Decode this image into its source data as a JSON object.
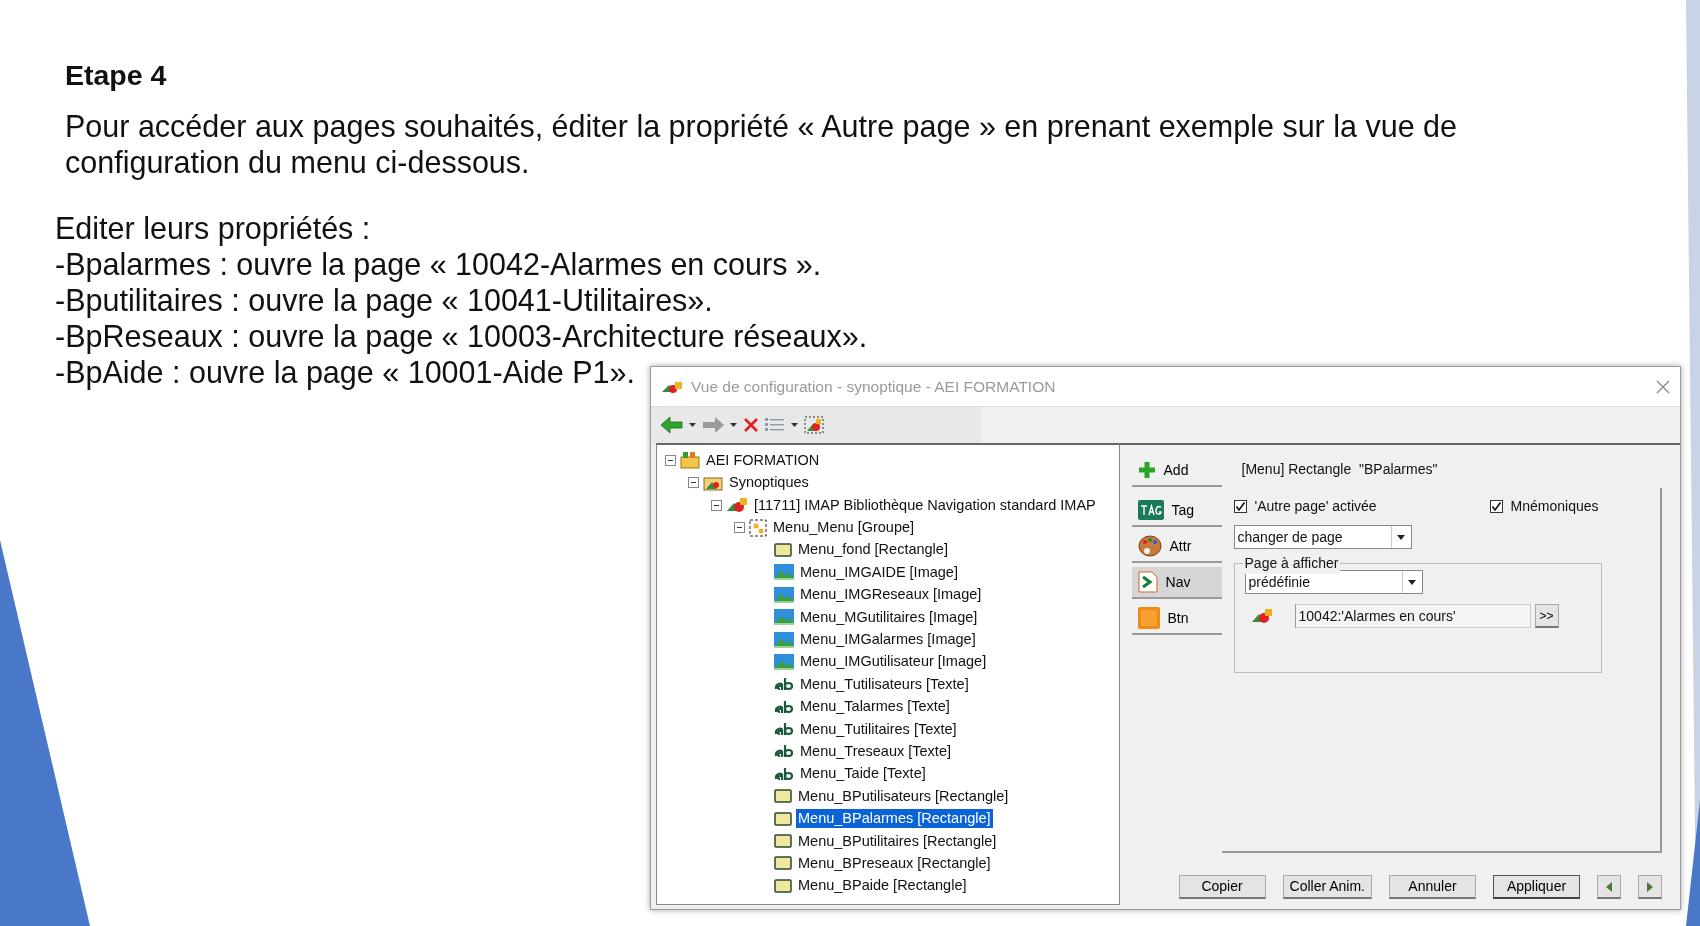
{
  "slide": {
    "title": "Etape 4",
    "intro": "Pour accéder aux pages souhaités, éditer la propriété « Autre page » en prenant exemple sur la vue de configuration du menu ci-dessous.",
    "list_heading": "Editer leurs propriétés :",
    "lines": [
      "-Bpalarmes : ouvre la page « 10042-Alarmes en cours ».",
      "-Bputilitaires : ouvre la page « 10041-Utilitaires».",
      "-BpReseaux : ouvre la page « 10003-Architecture réseaux».",
      "-BpAide : ouvre la page « 10001-Aide P1»."
    ]
  },
  "dialog": {
    "title": "Vue de configuration - synoptique - AEI FORMATION",
    "tree": [
      {
        "label": "AEI FORMATION",
        "kind": "project",
        "expanded": true,
        "selected": false,
        "children": [
          {
            "label": "Synoptiques",
            "kind": "folder",
            "expanded": true,
            "selected": false,
            "children": [
              {
                "label": "[11711]  IMAP Bibliothèque Navigation standard IMAP",
                "kind": "synoptic",
                "expanded": true,
                "selected": false,
                "children": [
                  {
                    "label": "Menu_Menu [Groupe]",
                    "kind": "group",
                    "expanded": true,
                    "selected": false,
                    "children": [
                      {
                        "label": "Menu_fond [Rectangle]",
                        "kind": "rectangle",
                        "selected": false
                      },
                      {
                        "label": "Menu_IMGAIDE [Image]",
                        "kind": "image",
                        "selected": false
                      },
                      {
                        "label": "Menu_IMGReseaux [Image]",
                        "kind": "image",
                        "selected": false
                      },
                      {
                        "label": "Menu_MGutilitaires [Image]",
                        "kind": "image",
                        "selected": false
                      },
                      {
                        "label": "Menu_IMGalarmes [Image]",
                        "kind": "image",
                        "selected": false
                      },
                      {
                        "label": "Menu_IMGutilisateur [Image]",
                        "kind": "image",
                        "selected": false
                      },
                      {
                        "label": "Menu_Tutilisateurs [Texte]",
                        "kind": "text",
                        "selected": false
                      },
                      {
                        "label": "Menu_Talarmes [Texte]",
                        "kind": "text",
                        "selected": false
                      },
                      {
                        "label": "Menu_Tutilitaires [Texte]",
                        "kind": "text",
                        "selected": false
                      },
                      {
                        "label": "Menu_Treseaux [Texte]",
                        "kind": "text",
                        "selected": false
                      },
                      {
                        "label": "Menu_Taide [Texte]",
                        "kind": "text",
                        "selected": false
                      },
                      {
                        "label": "Menu_BPutilisateurs [Rectangle]",
                        "kind": "rectangle",
                        "selected": false
                      },
                      {
                        "label": "Menu_BPalarmes [Rectangle]",
                        "kind": "rectangle",
                        "selected": true
                      },
                      {
                        "label": "Menu_BPutilitaires [Rectangle]",
                        "kind": "rectangle",
                        "selected": false
                      },
                      {
                        "label": "Menu_BPreseaux [Rectangle]",
                        "kind": "rectangle",
                        "selected": false
                      },
                      {
                        "label": "Menu_BPaide [Rectangle]",
                        "kind": "rectangle",
                        "selected": false
                      }
                    ]
                  }
                ]
              }
            ]
          }
        ]
      }
    ],
    "side_tabs": [
      {
        "label": "Add",
        "kind": "add",
        "selected": false
      },
      {
        "label": "Tag",
        "kind": "tag",
        "selected": false
      },
      {
        "label": "Attr",
        "kind": "attr",
        "selected": false
      },
      {
        "label": "Nav",
        "kind": "nav",
        "selected": true
      },
      {
        "label": "Btn",
        "kind": "btn",
        "selected": false
      }
    ],
    "header": "[Menu] Rectangle  \"BPalarmes\"",
    "checkboxes": [
      {
        "label": "'Autre page' activée",
        "checked": true
      },
      {
        "label": "Mnémoniques",
        "checked": true
      }
    ],
    "action_select": "changer de page",
    "group_label": "Page à afficher",
    "page_select": "prédéfinie",
    "page_field": "10042:'Alarmes en cours'",
    "browse_button": ">>",
    "buttons": [
      "Copier",
      "Coller Anim.",
      "Annuler",
      "Appliquer"
    ]
  }
}
